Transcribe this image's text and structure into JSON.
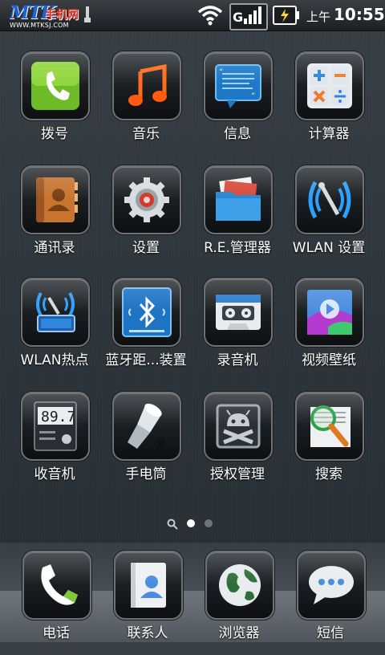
{
  "status_bar": {
    "brand_logo": "MTK",
    "brand_name": "手机网",
    "brand_url": "WWW.MTKSJ.COM",
    "signal_type": "G",
    "ampm": "上午",
    "time": "10:55",
    "icons": [
      "usb-icon",
      "wifi-icon",
      "signal-icon",
      "battery-charging-icon"
    ]
  },
  "apps": [
    {
      "label": "拨号",
      "icon": "phone-dialer-icon"
    },
    {
      "label": "音乐",
      "icon": "music-note-icon"
    },
    {
      "label": "信息",
      "icon": "message-bubble-icon"
    },
    {
      "label": "计算器",
      "icon": "calculator-icon"
    },
    {
      "label": "通讯录",
      "icon": "address-book-icon"
    },
    {
      "label": "设置",
      "icon": "gear-icon"
    },
    {
      "label": "R.E.管理器",
      "icon": "folder-icon"
    },
    {
      "label": "WLAN 设置",
      "icon": "wlan-settings-icon"
    },
    {
      "label": "WLAN热点",
      "icon": "hotspot-icon"
    },
    {
      "label": "蓝牙距...装置",
      "icon": "bluetooth-icon"
    },
    {
      "label": "录音机",
      "icon": "cassette-icon"
    },
    {
      "label": "视频壁纸",
      "icon": "video-wallpaper-icon"
    },
    {
      "label": "收音机",
      "icon": "radio-icon"
    },
    {
      "label": "手电筒",
      "icon": "flashlight-icon"
    },
    {
      "label": "授权管理",
      "icon": "android-skull-icon"
    },
    {
      "label": "搜索",
      "icon": "magnifier-icon"
    }
  ],
  "radio_display": "89.7",
  "pager": {
    "page_count": 2,
    "current_page": 1
  },
  "dock": [
    {
      "label": "电话",
      "icon": "handset-icon"
    },
    {
      "label": "联系人",
      "icon": "contacts-icon"
    },
    {
      "label": "浏览器",
      "icon": "globe-icon"
    },
    {
      "label": "短信",
      "icon": "chat-bubble-icon"
    }
  ]
}
